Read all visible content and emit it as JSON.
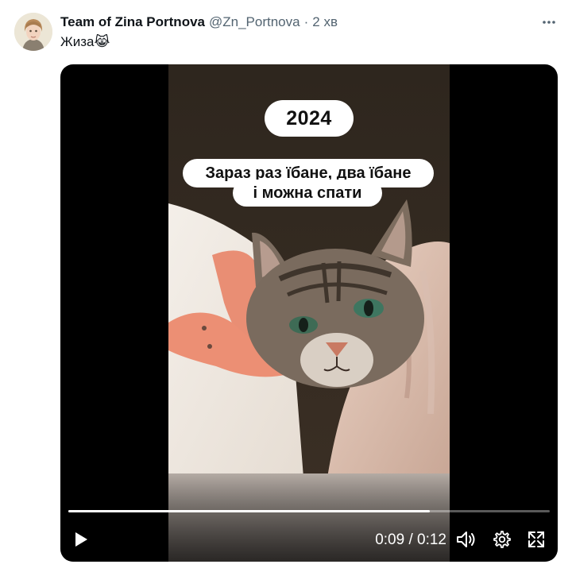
{
  "tweet": {
    "author_name": "Team of Zina Portnova",
    "author_handle": "@Zn_Portnova",
    "separator": "·",
    "time_ago": "2 хв",
    "text": "Жиза",
    "emoji": "😹",
    "more_icon": "more-horizontal-icon"
  },
  "video": {
    "year_label": "2024",
    "caption_line1": "Зараз раз їбане, два їбане",
    "caption_line2": "і можна спати",
    "current_time": "0:09",
    "time_separator": "/",
    "duration": "0:12",
    "progress_fraction": 0.75,
    "icons": {
      "play": "play-icon",
      "volume": "volume-icon",
      "settings": "settings-gear-icon",
      "fullscreen": "fullscreen-icon"
    }
  },
  "colors": {
    "text_primary": "#0f1419",
    "text_secondary": "#536471",
    "video_bg": "#000000",
    "controls": "#ffffff"
  }
}
